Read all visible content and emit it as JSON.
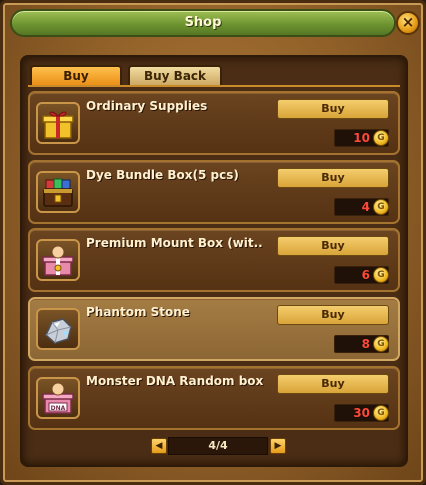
{
  "window": {
    "title": "Shop",
    "close_label": "×"
  },
  "tabs": [
    {
      "label": "Buy",
      "active": true
    },
    {
      "label": "Buy Back",
      "active": false
    }
  ],
  "items": [
    {
      "name": "Ordinary Supplies",
      "buy_label": "Buy",
      "price": "10",
      "icon": "gift-box-icon"
    },
    {
      "name": "Dye Bundle Box(5 pcs)",
      "buy_label": "Buy",
      "price": "4",
      "icon": "treasure-chest-icon"
    },
    {
      "name": "Premium Mount Box (wit..",
      "buy_label": "Buy",
      "price": "6",
      "icon": "mount-box-icon"
    },
    {
      "name": "Phantom Stone",
      "buy_label": "Buy",
      "price": "8",
      "icon": "crystal-stone-icon",
      "selected": true
    },
    {
      "name": "Monster DNA Random box",
      "buy_label": "Buy",
      "price": "30",
      "icon": "dna-box-icon"
    }
  ],
  "pagination": {
    "page_text": "4/4",
    "prev_icon": "arrow-left-icon",
    "next_icon": "arrow-right-icon"
  },
  "colors": {
    "title_bar": "#6e9430",
    "price_text": "#ff4a3a",
    "tab_active": "#e88a12",
    "coin": "#f0b820"
  }
}
